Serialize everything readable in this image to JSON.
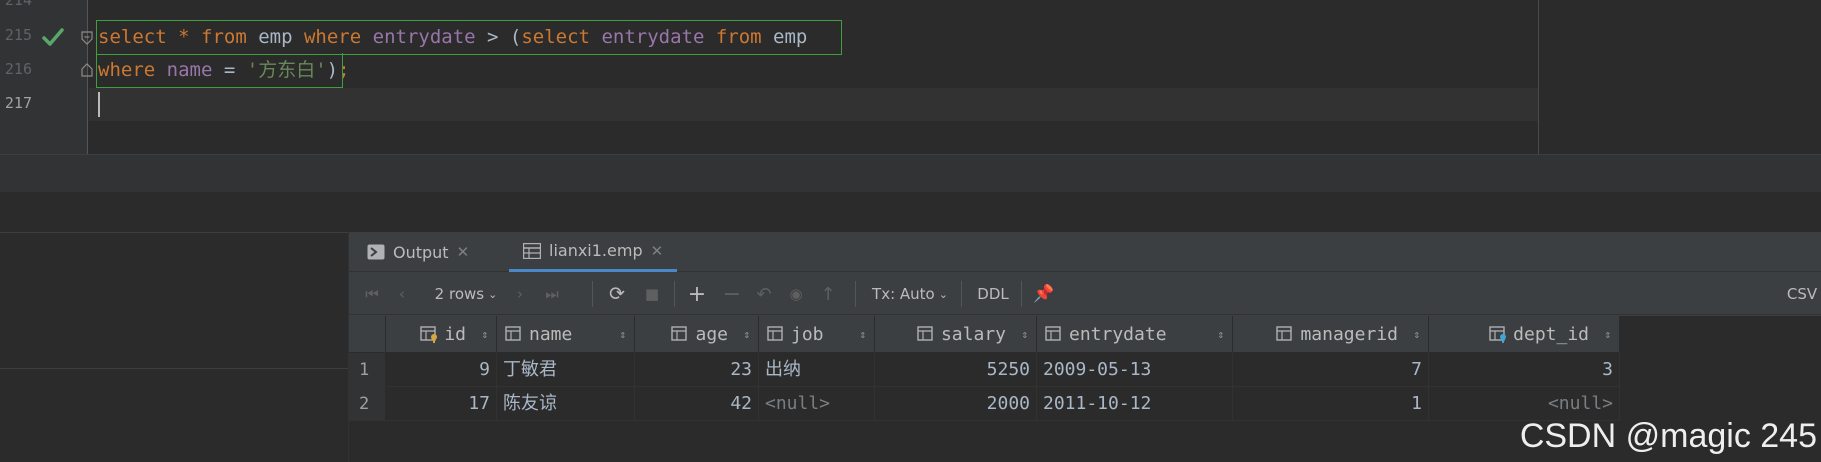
{
  "editor": {
    "line_numbers": [
      "214",
      "215",
      "216",
      "217"
    ],
    "line215": [
      {
        "t": "select",
        "c": "kw"
      },
      {
        "t": " ",
        "c": ""
      },
      {
        "t": "*",
        "c": "kw"
      },
      {
        "t": " ",
        "c": ""
      },
      {
        "t": "from",
        "c": "kw"
      },
      {
        "t": " emp ",
        "c": ""
      },
      {
        "t": "where",
        "c": "kw"
      },
      {
        "t": " ",
        "c": ""
      },
      {
        "t": "entrydate",
        "c": "col"
      },
      {
        "t": " > (",
        "c": ""
      },
      {
        "t": "select",
        "c": "kw"
      },
      {
        "t": " ",
        "c": ""
      },
      {
        "t": "entrydate",
        "c": "col"
      },
      {
        "t": " ",
        "c": ""
      },
      {
        "t": "from",
        "c": "kw"
      },
      {
        "t": " emp",
        "c": ""
      }
    ],
    "line216": [
      {
        "t": "where",
        "c": "kw"
      },
      {
        "t": " ",
        "c": ""
      },
      {
        "t": "name",
        "c": "col"
      },
      {
        "t": " = ",
        "c": ""
      },
      {
        "t": "'方东白'",
        "c": "str"
      },
      {
        "t": ")",
        "c": ""
      },
      {
        "t": ";",
        "c": "kw"
      }
    ]
  },
  "tabs": [
    {
      "label": "Output",
      "icon": "console-icon"
    },
    {
      "label": "lianxi1.emp",
      "icon": "table-icon"
    }
  ],
  "toolbar": {
    "rows_label": "2 rows",
    "tx_label": "Tx: Auto",
    "ddl_label": "DDL",
    "export_label": "CSV"
  },
  "grid": {
    "columns": [
      {
        "name": "id",
        "icon": "primary-key-column-icon"
      },
      {
        "name": "name",
        "icon": "column-icon"
      },
      {
        "name": "age",
        "icon": "column-icon"
      },
      {
        "name": "job",
        "icon": "column-icon"
      },
      {
        "name": "salary",
        "icon": "column-icon"
      },
      {
        "name": "entrydate",
        "icon": "column-icon"
      },
      {
        "name": "managerid",
        "icon": "column-icon"
      },
      {
        "name": "dept_id",
        "icon": "foreign-key-column-icon"
      }
    ],
    "rows": [
      {
        "n": "1",
        "cells": [
          "9",
          "丁敏君",
          "23",
          "出纳",
          "5250",
          "2009-05-13",
          "7",
          "3"
        ]
      },
      {
        "n": "2",
        "cells": [
          "17",
          "陈友谅",
          "42",
          "<null>",
          "2000",
          "2011-10-12",
          "1",
          "<null>"
        ]
      }
    ]
  },
  "watermark": "CSDN @magic 245",
  "colors": {
    "keyword": "#cc7832",
    "identifier": "#9876aa",
    "string": "#6a8759",
    "selection_box": "#3f9f3f",
    "active_tab_underline": "#4a88c7"
  }
}
